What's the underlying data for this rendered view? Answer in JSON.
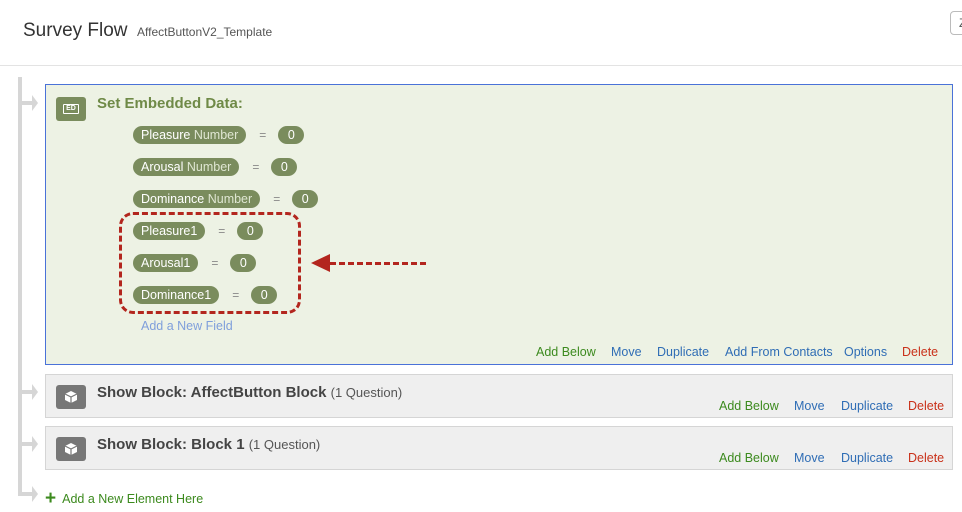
{
  "header": {
    "title": "Survey Flow",
    "survey_name": "AffectButtonV2_Template",
    "corner_button_text": "Z"
  },
  "embedded_block": {
    "icon_label": "ED",
    "title": "Set Embedded Data:",
    "fields": [
      {
        "name": "Pleasure",
        "type": "Number",
        "value": "0"
      },
      {
        "name": "Arousal",
        "type": "Number",
        "value": "0"
      },
      {
        "name": "Dominance",
        "type": "Number",
        "value": "0"
      },
      {
        "name": "Pleasure1",
        "type": "",
        "value": "0"
      },
      {
        "name": "Arousal1",
        "type": "",
        "value": "0"
      },
      {
        "name": "Dominance1",
        "type": "",
        "value": "0"
      }
    ],
    "equals": "=",
    "add_field_label": "Add a New Field",
    "actions": {
      "add_below": "Add Below",
      "move": "Move",
      "duplicate": "Duplicate",
      "add_from_contacts": "Add From Contacts",
      "options": "Options",
      "delete": "Delete"
    }
  },
  "show_blocks": [
    {
      "title": "Show Block: AffectButton Block",
      "count": "(1 Question)"
    },
    {
      "title": "Show Block: Block 1",
      "count": "(1 Question)"
    }
  ],
  "block_actions": {
    "add_below": "Add Below",
    "move": "Move",
    "duplicate": "Duplicate",
    "delete": "Delete"
  },
  "add_element_label": "Add a New Element Here",
  "colors": {
    "embedded_bg": "#edf2e4",
    "pill": "#7a8c5d",
    "annotation_red": "#b3261e",
    "action_green": "#3c8a1e",
    "action_blue": "#2f6db5",
    "action_red": "#c9311a",
    "selection_border": "#4a72d8"
  }
}
